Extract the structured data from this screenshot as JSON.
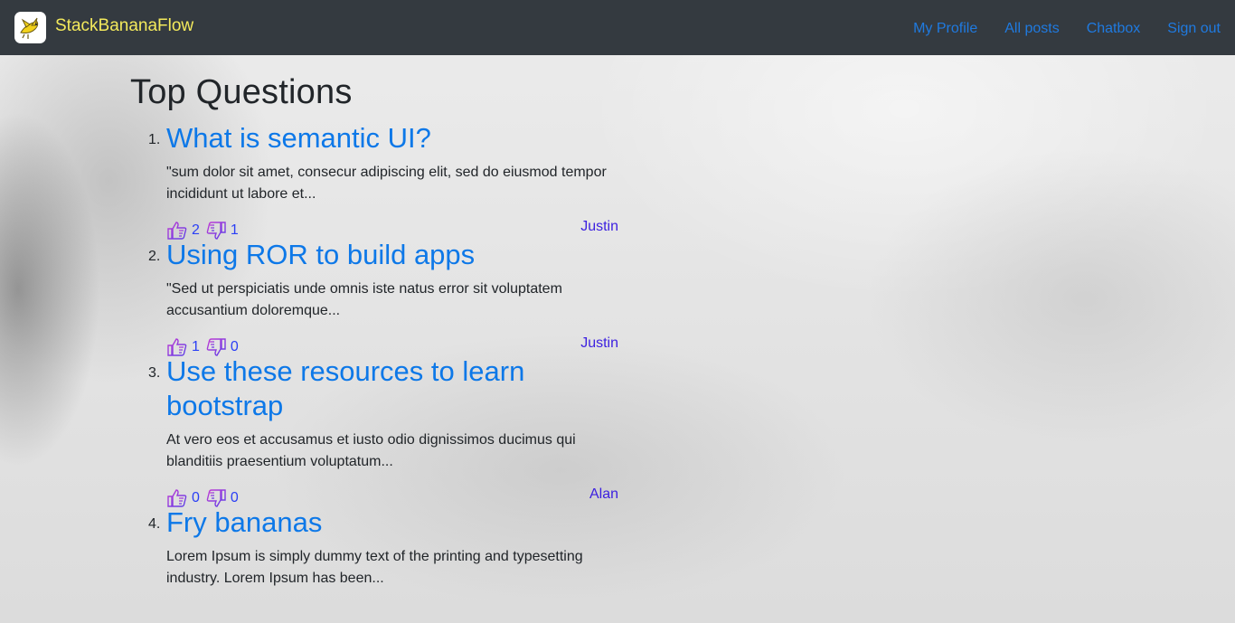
{
  "navbar": {
    "brand": "StackBananaFlow",
    "logo_icon": "banana-bird-logo-icon",
    "links": [
      "My Profile",
      "All posts",
      "Chatbox",
      "Sign out"
    ]
  },
  "page": {
    "title": "Top Questions"
  },
  "questions": [
    {
      "number": "1.",
      "title": "What is semantic UI?",
      "excerpt": "\"sum dolor sit amet, consecur adipiscing elit, sed do eiusmod tempor incididunt ut labore et...",
      "upvotes": "2",
      "downvotes": "1",
      "author": "Justin"
    },
    {
      "number": "2.",
      "title": "Using ROR to build apps",
      "excerpt": "\"Sed ut perspiciatis unde omnis iste natus error sit voluptatem accusantium doloremque...",
      "upvotes": "1",
      "downvotes": "0",
      "author": "Justin"
    },
    {
      "number": "3.",
      "title": "Use these resources to learn bootstrap",
      "excerpt": "At vero eos et accusamus et iusto odio dignissimos ducimus qui blanditiis praesentium voluptatum...",
      "upvotes": "0",
      "downvotes": "0",
      "author": "Alan"
    },
    {
      "number": "4.",
      "title": "Fry bananas",
      "excerpt": "Lorem Ipsum is simply dummy text of the printing and typesetting industry. Lorem Ipsum has been...",
      "upvotes": "",
      "downvotes": "",
      "author": ""
    }
  ],
  "colors": {
    "navbar_bg": "#343a40",
    "brand": "#f4ea5c",
    "link": "#1f7ae0",
    "question_title": "#0d78e8",
    "vote_count": "#2a3ff5",
    "author": "#3b1fe0"
  },
  "icons": {
    "upvote": "thumbs-up-icon",
    "downvote": "thumbs-down-icon"
  }
}
